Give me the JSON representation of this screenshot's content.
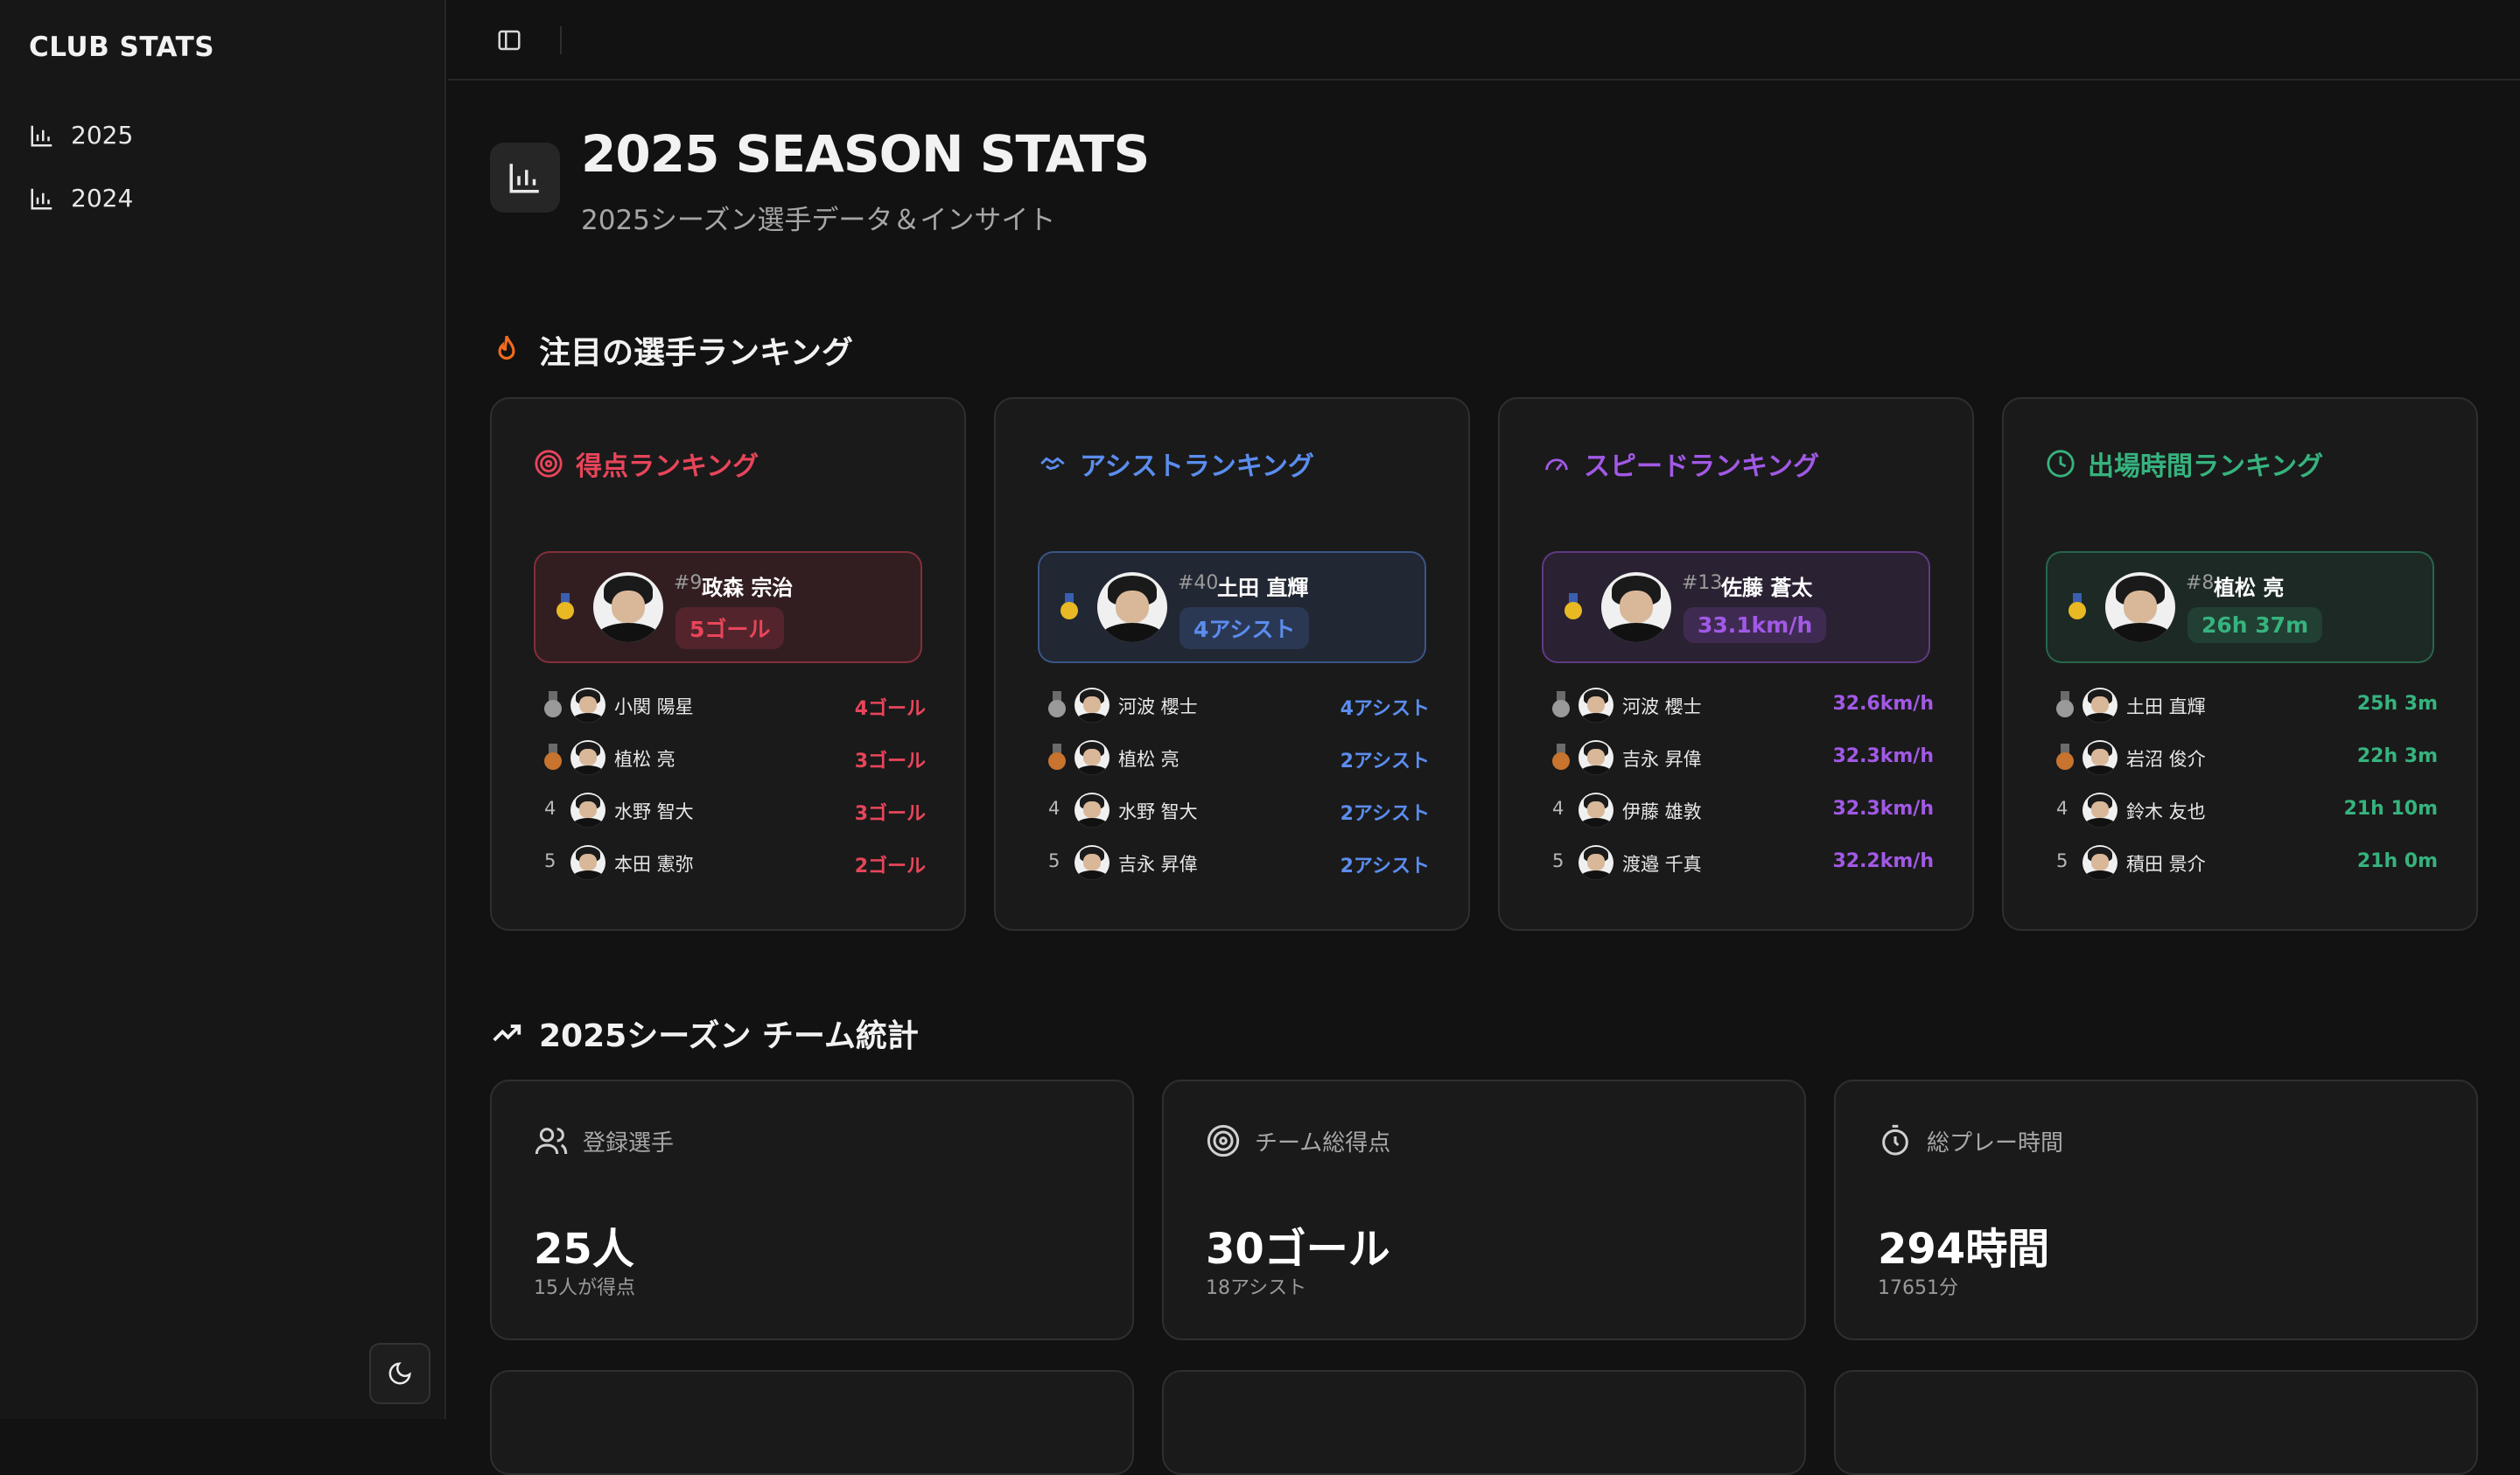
{
  "sidebar": {
    "brand": "CLUB STATS",
    "items": [
      {
        "label": "2025"
      },
      {
        "label": "2024"
      }
    ]
  },
  "header": {
    "title": "2025 SEASON STATS",
    "subtitle": "2025シーズン選手データ＆インサイト"
  },
  "rankings_section": {
    "title": "注目の選手ランキング",
    "cards": [
      {
        "title": "得点ランキング",
        "accent": "#e8455a",
        "top": {
          "number": "#9",
          "name": "政森 宗治",
          "stat": "5ゴール"
        },
        "rows": [
          {
            "pos": "2",
            "name": "小関 陽星",
            "value": "4ゴール"
          },
          {
            "pos": "3",
            "name": "植松 亮",
            "value": "3ゴール"
          },
          {
            "pos": "4",
            "name": "水野 智大",
            "value": "3ゴール"
          },
          {
            "pos": "5",
            "name": "本田 憲弥",
            "value": "2ゴール"
          }
        ]
      },
      {
        "title": "アシストランキング",
        "accent": "#5b8def",
        "top": {
          "number": "#40",
          "name": "土田 直輝",
          "stat": "4アシスト"
        },
        "rows": [
          {
            "pos": "2",
            "name": "河波 櫻士",
            "value": "4アシスト"
          },
          {
            "pos": "3",
            "name": "植松 亮",
            "value": "2アシスト"
          },
          {
            "pos": "4",
            "name": "水野 智大",
            "value": "2アシスト"
          },
          {
            "pos": "5",
            "name": "吉永 昇偉",
            "value": "2アシスト"
          }
        ]
      },
      {
        "title": "スピードランキング",
        "accent": "#a259e6",
        "top": {
          "number": "#13",
          "name": "佐藤 蒼太",
          "stat": "33.1km/h"
        },
        "rows": [
          {
            "pos": "2",
            "name": "河波 櫻士",
            "value": "32.6km/h"
          },
          {
            "pos": "3",
            "name": "吉永 昇偉",
            "value": "32.3km/h"
          },
          {
            "pos": "4",
            "name": "伊藤 雄敦",
            "value": "32.3km/h"
          },
          {
            "pos": "5",
            "name": "渡邉 千真",
            "value": "32.2km/h"
          }
        ]
      },
      {
        "title": "出場時間ランキング",
        "accent": "#36b37e",
        "top": {
          "number": "#8",
          "name": "植松 亮",
          "stat": "26h 37m"
        },
        "rows": [
          {
            "pos": "2",
            "name": "土田 直輝",
            "value": "25h 3m"
          },
          {
            "pos": "3",
            "name": "岩沼 俊介",
            "value": "22h 3m"
          },
          {
            "pos": "4",
            "name": "鈴木 友也",
            "value": "21h 10m"
          },
          {
            "pos": "5",
            "name": "積田 景介",
            "value": "21h 0m"
          }
        ]
      }
    ]
  },
  "team_section": {
    "title": "2025シーズン チーム統計",
    "cards": [
      {
        "label": "登録選手",
        "value": "25人",
        "sub": "15人が得点"
      },
      {
        "label": "チーム総得点",
        "value": "30ゴール",
        "sub": "18アシスト"
      },
      {
        "label": "総プレー時間",
        "value": "294時間",
        "sub": "17651分"
      }
    ]
  }
}
